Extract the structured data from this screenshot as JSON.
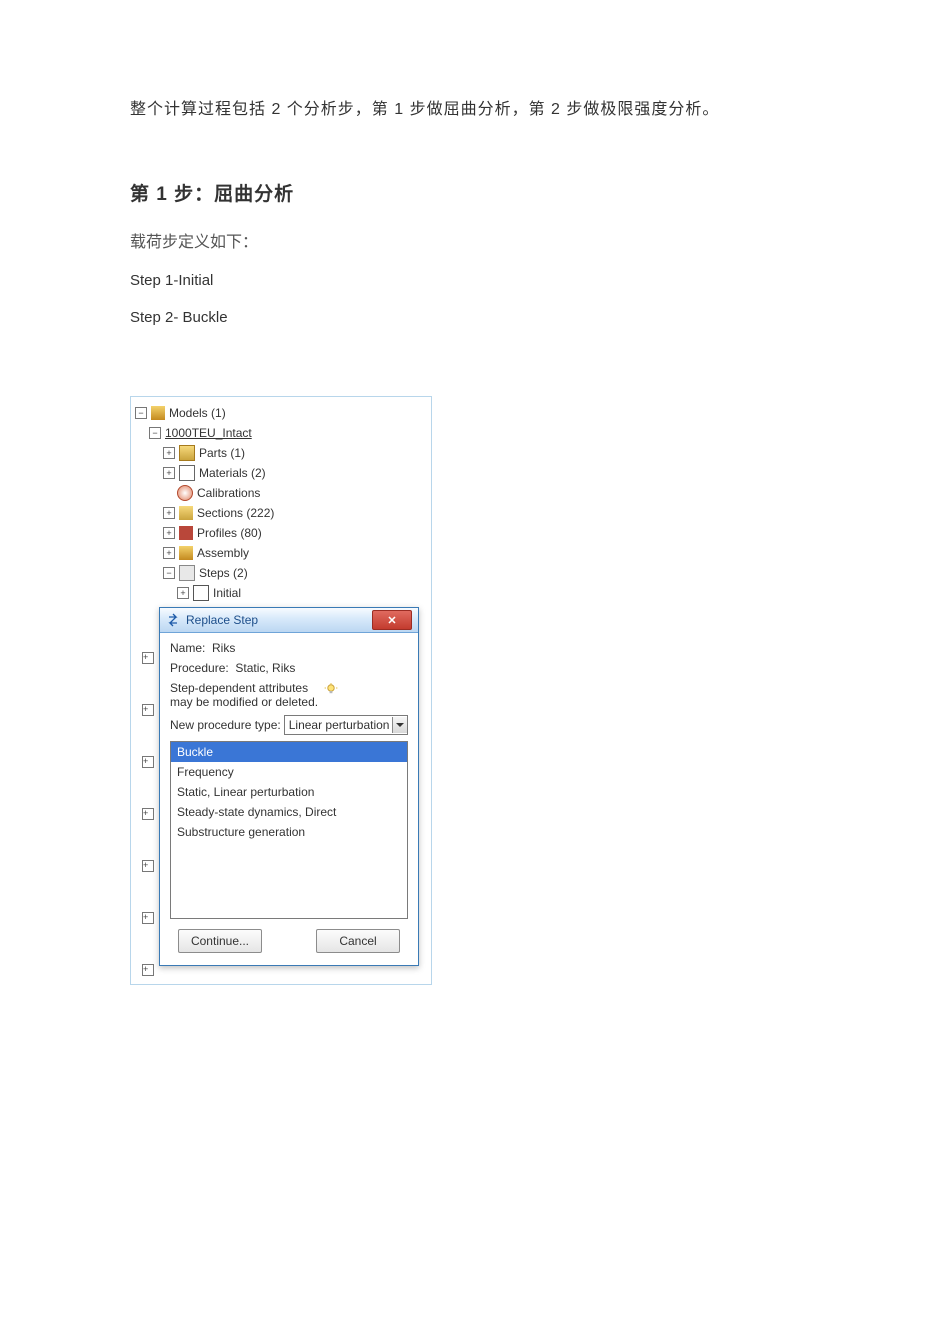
{
  "doc": {
    "intro": "整个计算过程包括 2 个分析步，第 1 步做屈曲分析，第 2 步做极限强度分析。",
    "heading": "第 1 步：屈曲分析",
    "sub": "载荷步定义如下：",
    "step1": "Step  1-Initial",
    "step2": "Step  2-  Buckle"
  },
  "tree": {
    "root": "Models (1)",
    "model": "1000TEU_Intact",
    "parts": "Parts (1)",
    "materials": "Materials (2)",
    "calibrations": "Calibrations",
    "sections": "Sections (222)",
    "profiles": "Profiles (80)",
    "assembly": "Assembly",
    "steps": "Steps (2)",
    "initial": "Initial"
  },
  "dialog": {
    "title": "Replace Step",
    "name_label": "Name:",
    "name_value": "Riks",
    "proc_label": "Procedure:",
    "proc_value": "Static, Riks",
    "attr_line1": "Step-dependent attributes",
    "attr_line2": "may be modified or deleted.",
    "newproc_label": "New procedure type:",
    "newproc_value": "Linear perturbation",
    "options": [
      "Buckle",
      "Frequency",
      "Static, Linear perturbation",
      "Steady-state dynamics, Direct",
      "Substructure generation"
    ],
    "selected_index": 0,
    "continue_btn": "Continue...",
    "cancel_btn": "Cancel"
  }
}
